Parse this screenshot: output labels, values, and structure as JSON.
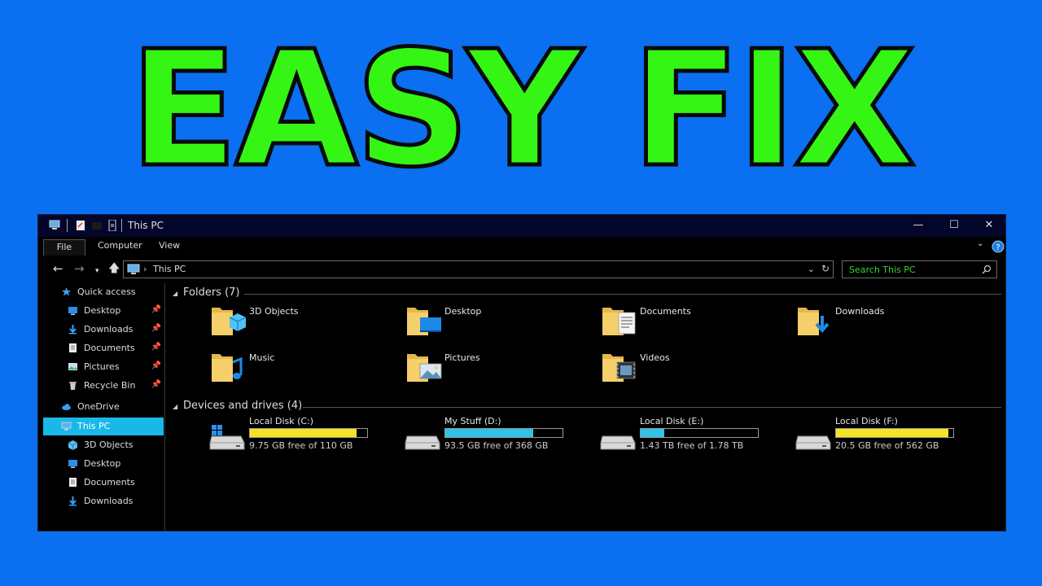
{
  "headline": "EASY FIX",
  "window": {
    "title": "This PC",
    "ribbon_tabs": [
      "File",
      "Computer",
      "View"
    ],
    "address": "This PC",
    "search_placeholder": "Search This PC"
  },
  "sidebar": {
    "items": [
      {
        "label": "Quick access",
        "icon": "star-icon",
        "pinned": false
      },
      {
        "label": "Desktop",
        "icon": "desktop-icon",
        "pinned": true
      },
      {
        "label": "Downloads",
        "icon": "download-icon",
        "pinned": true
      },
      {
        "label": "Documents",
        "icon": "document-icon",
        "pinned": true
      },
      {
        "label": "Pictures",
        "icon": "pictures-icon",
        "pinned": true
      },
      {
        "label": "Recycle Bin",
        "icon": "recycle-bin-icon",
        "pinned": true
      },
      {
        "label": "OneDrive",
        "icon": "cloud-icon",
        "pinned": false
      },
      {
        "label": "This PC",
        "icon": "computer-icon",
        "pinned": false,
        "selected": true
      },
      {
        "label": "3D Objects",
        "icon": "cube-icon",
        "pinned": false
      },
      {
        "label": "Desktop",
        "icon": "desktop-icon",
        "pinned": false
      },
      {
        "label": "Documents",
        "icon": "document-icon",
        "pinned": false
      },
      {
        "label": "Downloads",
        "icon": "download-icon",
        "pinned": false
      }
    ]
  },
  "folders": {
    "header": "Folders (7)",
    "items": [
      {
        "label": "3D Objects",
        "icon": "folder-3d-icon"
      },
      {
        "label": "Desktop",
        "icon": "folder-desktop-icon"
      },
      {
        "label": "Documents",
        "icon": "folder-documents-icon"
      },
      {
        "label": "Downloads",
        "icon": "folder-downloads-icon"
      },
      {
        "label": "Music",
        "icon": "folder-music-icon"
      },
      {
        "label": "Pictures",
        "icon": "folder-pictures-icon"
      },
      {
        "label": "Videos",
        "icon": "folder-videos-icon"
      }
    ]
  },
  "drives": {
    "header": "Devices and drives (4)",
    "items": [
      {
        "label": "Local Disk (C:)",
        "free": "9.75 GB free of 110 GB",
        "used_fraction": 0.91,
        "bar_color": "#f5e326",
        "windows_logo": true
      },
      {
        "label": "My Stuff (D:)",
        "free": "93.5 GB free of 368 GB",
        "used_fraction": 0.75,
        "bar_color": "#2ec4e8",
        "windows_logo": false
      },
      {
        "label": "Local Disk (E:)",
        "free": "1.43 TB free of 1.78 TB",
        "used_fraction": 0.2,
        "bar_color": "#2ec4e8",
        "windows_logo": false
      },
      {
        "label": "Local Disk (F:)",
        "free": "20.5 GB free of 562 GB",
        "used_fraction": 0.96,
        "bar_color": "#f5e326",
        "windows_logo": false
      }
    ]
  },
  "colors": {
    "background": "#0a6ff0",
    "headline": "#35f515",
    "selection": "#1ab8e8"
  }
}
